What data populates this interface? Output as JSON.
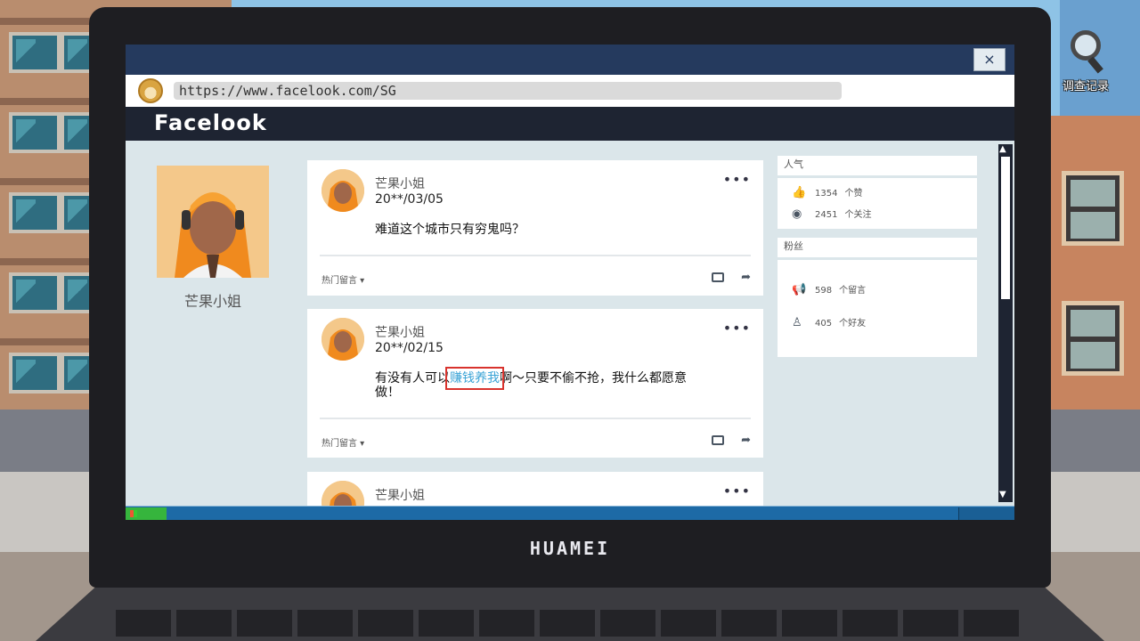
{
  "browser": {
    "url": "https://www.facelook.com/SG",
    "close_label": "×"
  },
  "site": {
    "title": "Facelook"
  },
  "profile": {
    "name": "芒果小姐"
  },
  "posts": [
    {
      "author": "芒果小姐",
      "date": "20**/03/05",
      "content": "难道这个城市只有穷鬼吗？",
      "sort_label": "热门留言",
      "menu": "•••"
    },
    {
      "author": "芒果小姐",
      "date": "20**/02/15",
      "content_before": "有没有人可以",
      "content_highlight": "赚钱养我",
      "content_after": "啊～只要不偷不抢，我什么都愿意做！",
      "sort_label": "热门留言",
      "menu": "•••"
    },
    {
      "author": "芒果小姐",
      "menu": "•••"
    }
  ],
  "sidebar": {
    "popularity": {
      "header": "人气",
      "likes": {
        "icon": "thumbs-up-icon",
        "value": "1354",
        "unit": "个赞"
      },
      "follows": {
        "icon": "eye-icon",
        "value": "2451",
        "unit": "个关注"
      }
    },
    "fans": {
      "header": "粉丝",
      "comments": {
        "icon": "megaphone-icon",
        "value": "598",
        "unit": "个留言"
      },
      "friends": {
        "icon": "person-icon",
        "value": "405",
        "unit": "个好友"
      }
    }
  },
  "laptop": {
    "brand": "HUAMEI"
  },
  "desktop_icon": {
    "label": "调查记录",
    "icon": "magnifier-icon"
  },
  "colors": {
    "highlight_text": "#3aa3d6",
    "highlight_box": "#d8332d",
    "titlebar": "#253a5e",
    "taskbar": "#1d6aa6"
  }
}
